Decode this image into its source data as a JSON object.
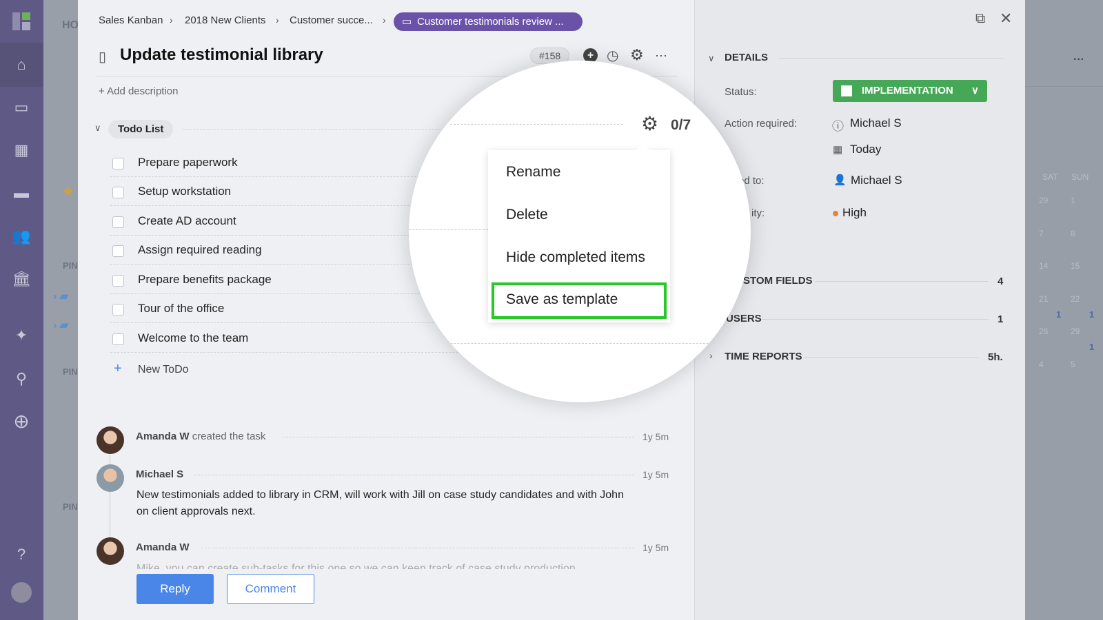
{
  "breadcrumb": [
    "Sales Kanban",
    "2018 New Clients",
    "Customer succe...",
    "Customer testimonials review ..."
  ],
  "task": {
    "title": "Update testimonial library",
    "id": "#158",
    "add_description": "+ Add description"
  },
  "todo": {
    "label": "Todo List",
    "progress": "0/7",
    "items": [
      "Prepare paperwork",
      "Setup workstation",
      "Create AD account",
      "Assign required reading",
      "Prepare benefits package",
      "Tour of the office",
      "Welcome to the team"
    ],
    "new": "New ToDo"
  },
  "menu": {
    "items": [
      "Rename",
      "Delete",
      "Hide completed items",
      "Save as template"
    ],
    "highlight_color": "#28c828"
  },
  "activity": [
    {
      "author": "Amanda W",
      "action": "created the task",
      "time": "1y 5m"
    },
    {
      "author": "Michael S",
      "text": "New testimonials added to library in CRM, will work with Jill on case study candidates and with John on client approvals next.",
      "time": "1y 5m"
    },
    {
      "author": "Amanda W",
      "text": "Mike, you can create sub-tasks for this one so we can keep track of case study production",
      "time": "1y 5m"
    }
  ],
  "buttons": {
    "reply": "Reply",
    "comment": "Comment"
  },
  "details": {
    "header": "DETAILS",
    "status_label": "Status:",
    "status": "IMPLEMENTATION",
    "status_color": "#45a856",
    "action_label": "Action required:",
    "action_user": "Michael S",
    "action_date": "Today",
    "assigned_label": "igned to:",
    "assigned": "Michael S",
    "priority_label": "ity:",
    "priority": "High"
  },
  "sections": [
    {
      "name": "STOM FIELDS",
      "count": "4"
    },
    {
      "name": "USERS",
      "count": "1"
    },
    {
      "name": "TIME REPORTS",
      "count": "5h."
    }
  ],
  "sidebar2": {
    "header": "HO",
    "pins": [
      "PIN",
      "PIN",
      "PIN"
    ]
  },
  "calendar": {
    "days": [
      "SAT",
      "SUN"
    ],
    "rows": [
      [
        "29",
        "1"
      ],
      [
        "7",
        "8"
      ],
      [
        "14",
        "15"
      ],
      [
        "21",
        "22"
      ],
      [
        "28",
        "29"
      ],
      [
        "4",
        "5"
      ]
    ],
    "badges": [
      "1",
      "1",
      "1"
    ]
  }
}
